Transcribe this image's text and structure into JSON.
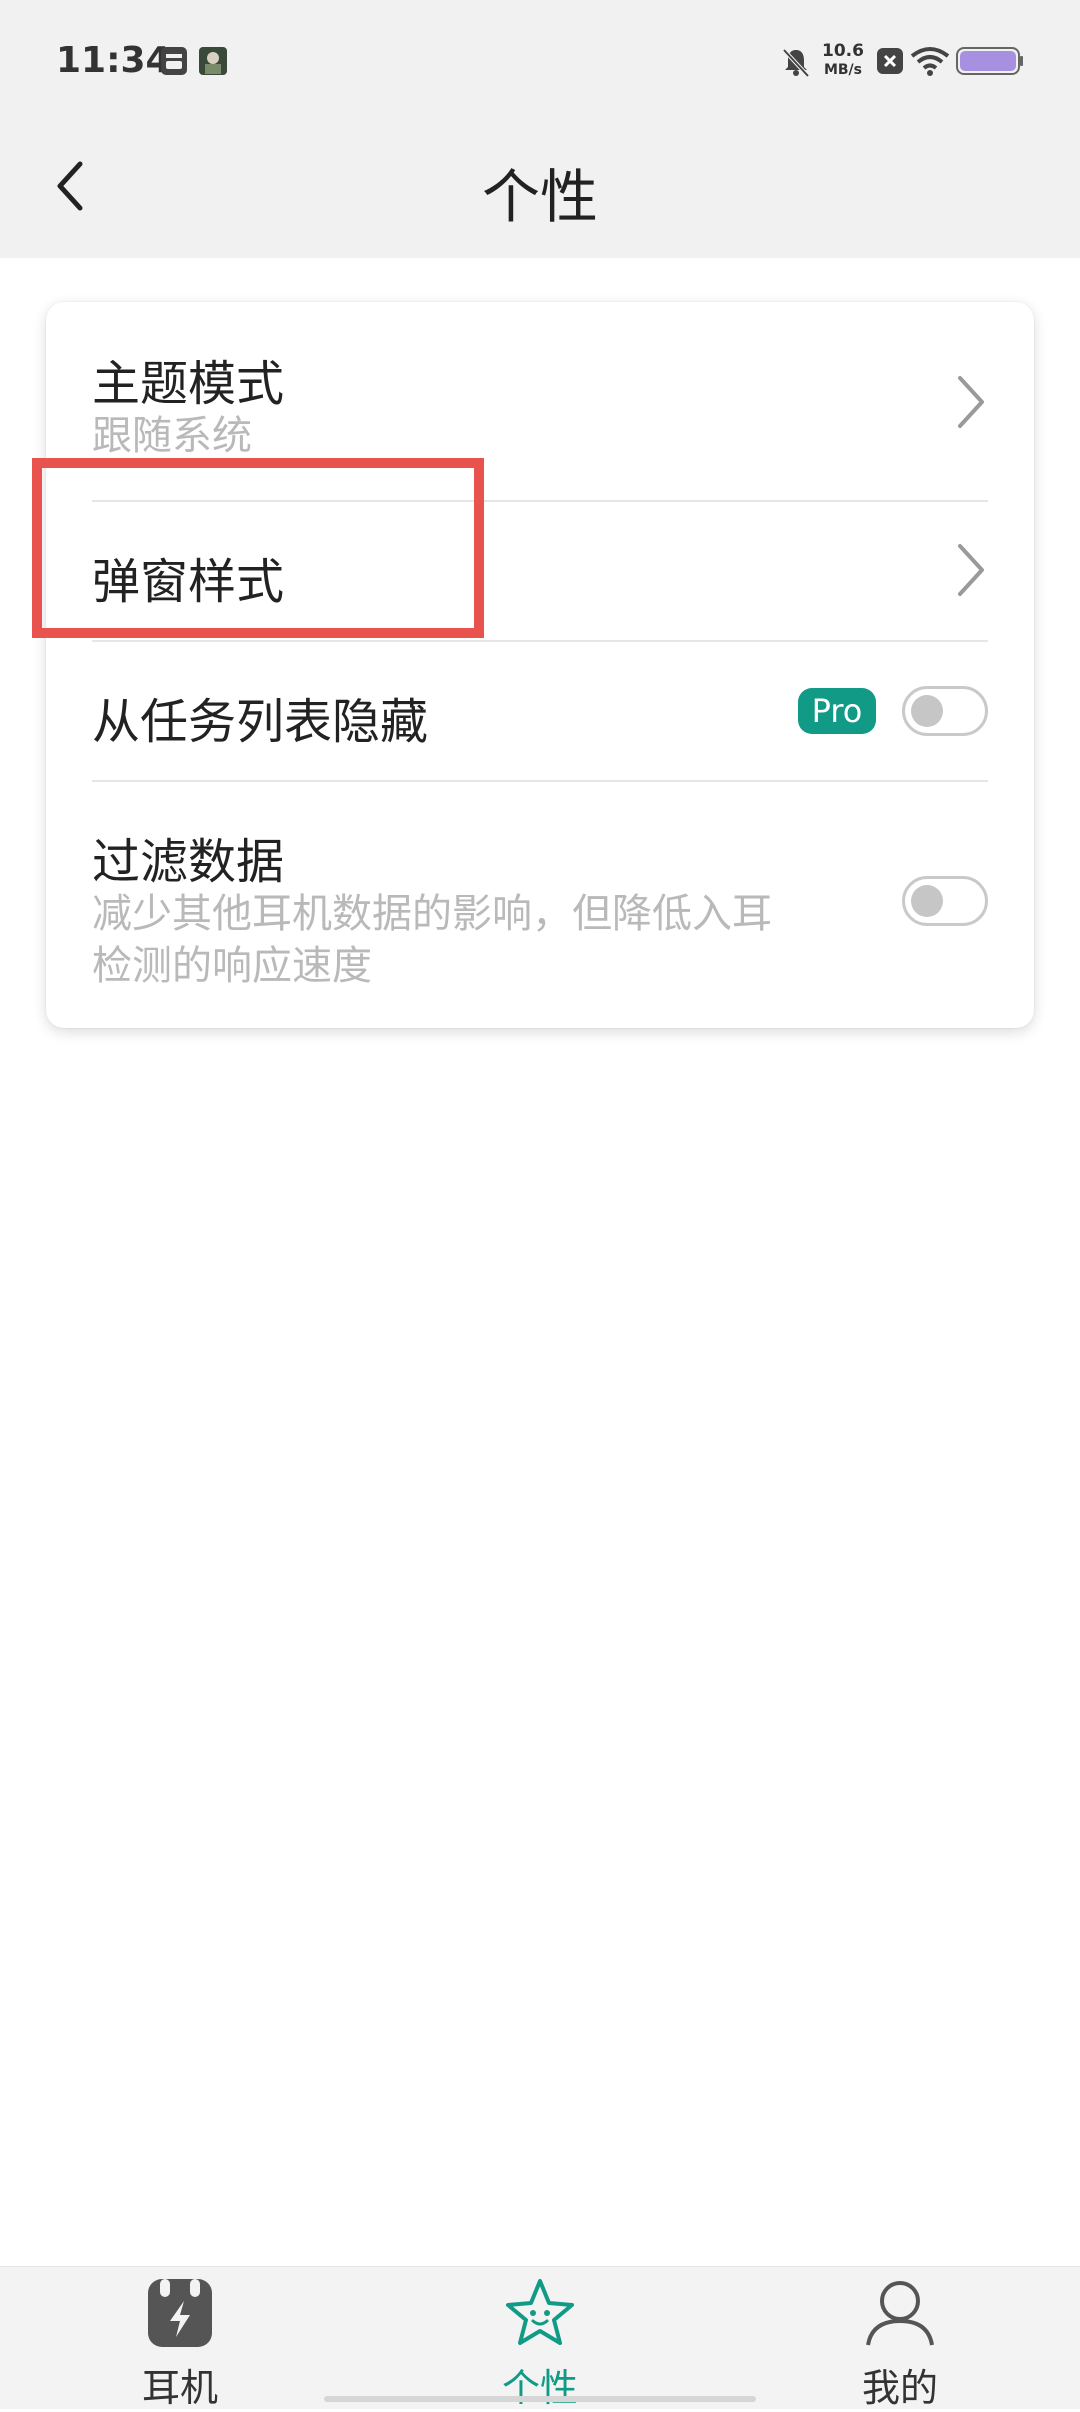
{
  "status_bar": {
    "time": "11:34",
    "net_speed_value": "10.6",
    "net_speed_unit": "MB/s",
    "icons": [
      "sim-card-icon",
      "app-thumbnail-icon",
      "mute-bell-icon",
      "close-box-icon",
      "wifi-icon",
      "battery-icon"
    ]
  },
  "header": {
    "title": "个性",
    "back_icon": "back-chevron-icon"
  },
  "settings": {
    "theme": {
      "title": "主题模式",
      "subtitle": "跟随系统"
    },
    "popup": {
      "title": "弹窗样式"
    },
    "hide_recents": {
      "title": "从任务列表隐藏",
      "badge": "Pro",
      "enabled": false
    },
    "filter": {
      "title": "过滤数据",
      "subtitle_line1": "减少其他耳机数据的影响，但降低入耳",
      "subtitle_line2": "检测的响应速度",
      "enabled": false
    }
  },
  "bottom_nav": {
    "items": [
      {
        "label": "耳机",
        "icon": "earbuds-icon",
        "active": false
      },
      {
        "label": "个性",
        "icon": "star-face-icon",
        "active": true
      },
      {
        "label": "我的",
        "icon": "person-icon",
        "active": false
      }
    ]
  },
  "colors": {
    "accent": "#119a85",
    "highlight": "#e8534e"
  }
}
